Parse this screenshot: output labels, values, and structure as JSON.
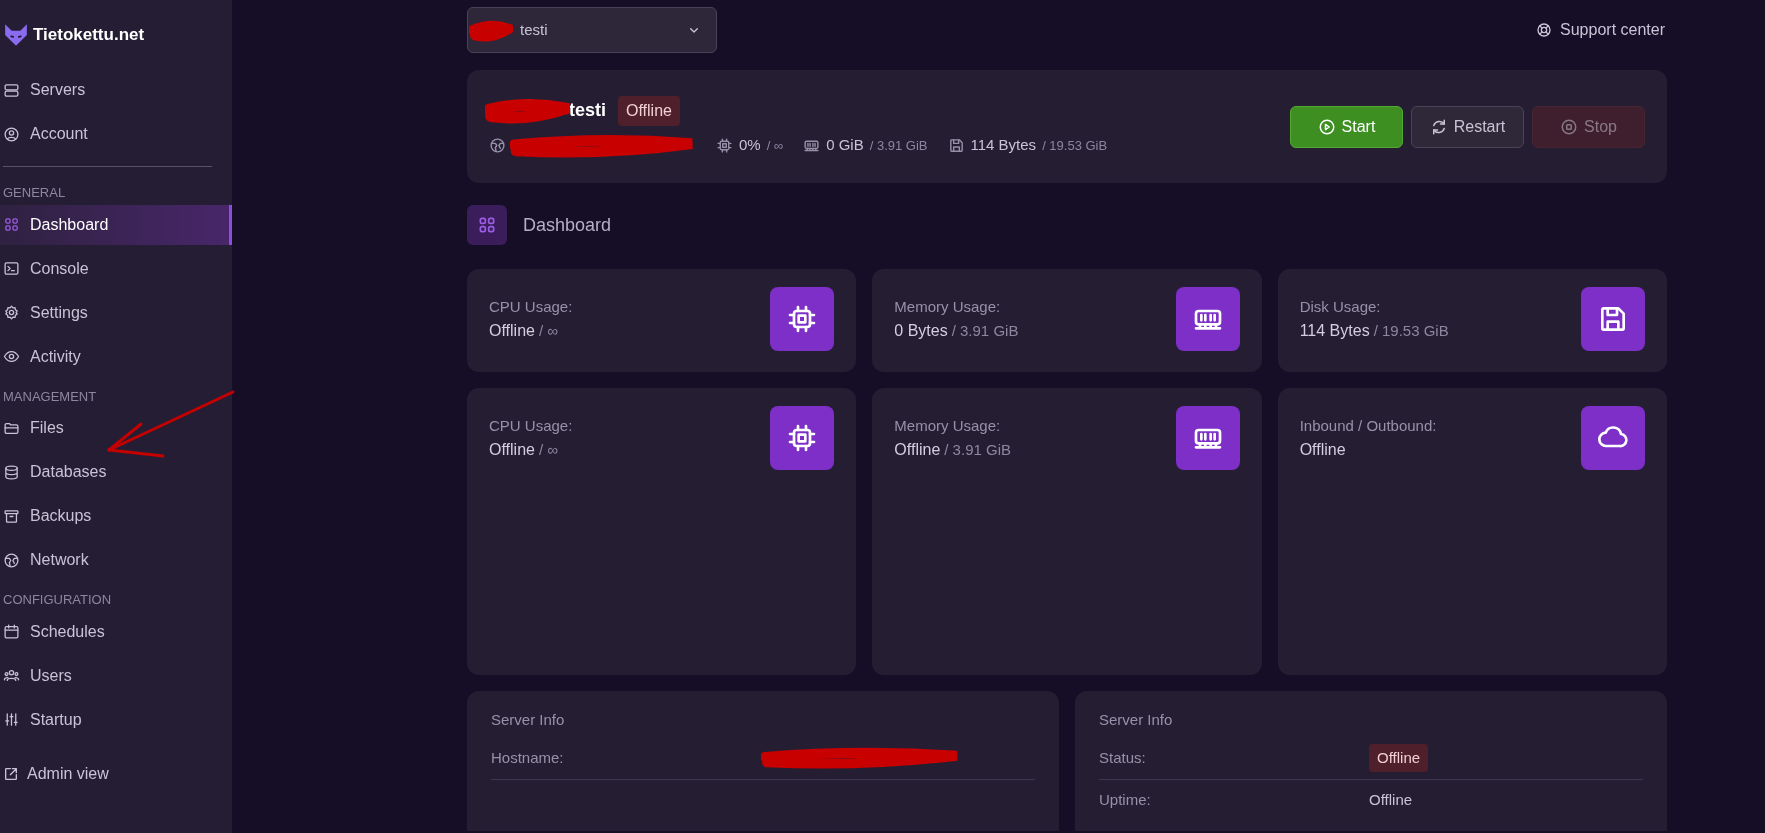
{
  "brand": {
    "name": "Tietokettu.net"
  },
  "sidebar": {
    "top_items": [
      {
        "label": "Servers",
        "kind": "server",
        "selected": false
      },
      {
        "label": "Account",
        "kind": "user",
        "selected": false
      }
    ],
    "sections": [
      {
        "title": "GENERAL",
        "items": [
          {
            "label": "Dashboard",
            "kind": "grid",
            "selected": true
          },
          {
            "label": "Console",
            "kind": "terminal",
            "selected": false
          },
          {
            "label": "Settings",
            "kind": "gear",
            "selected": false
          },
          {
            "label": "Activity",
            "kind": "eye",
            "selected": false
          }
        ]
      },
      {
        "title": "MANAGEMENT",
        "items": [
          {
            "label": "Files",
            "kind": "folder",
            "selected": false
          },
          {
            "label": "Databases",
            "kind": "database",
            "selected": false
          },
          {
            "label": "Backups",
            "kind": "archive",
            "selected": false
          },
          {
            "label": "Network",
            "kind": "globe",
            "selected": false
          }
        ]
      },
      {
        "title": "CONFIGURATION",
        "items": [
          {
            "label": "Schedules",
            "kind": "calendar",
            "selected": false
          },
          {
            "label": "Users",
            "kind": "users",
            "selected": false
          },
          {
            "label": "Startup",
            "kind": "sliders",
            "selected": false
          }
        ]
      }
    ],
    "footer_item": {
      "label": "Admin view",
      "kind": "external"
    }
  },
  "server_select": {
    "value": "testi"
  },
  "support_link": {
    "label": "Support center"
  },
  "server": {
    "name": "testi",
    "status": "Offline",
    "stats": [
      {
        "kind": "cpu",
        "value": "0%",
        "limit": "/ ∞"
      },
      {
        "kind": "memory",
        "value": "0 GiB",
        "limit": "/ 3.91 GiB"
      },
      {
        "kind": "disk",
        "value": "114 Bytes",
        "limit": "/ 19.53 GiB"
      }
    ]
  },
  "actions": [
    {
      "label": "Start",
      "kind": "start",
      "disabled": false
    },
    {
      "label": "Restart",
      "kind": "restart",
      "disabled": false
    },
    {
      "label": "Stop",
      "kind": "stop",
      "disabled": true
    }
  ],
  "page_title": "Dashboard",
  "stat_cards": [
    {
      "label": "CPU Usage:",
      "value": "Offline",
      "limit": "/ ∞",
      "kind": "cpu"
    },
    {
      "label": "Memory Usage:",
      "value": "0 Bytes",
      "limit": "/ 3.91 GiB",
      "kind": "memory"
    },
    {
      "label": "Disk Usage:",
      "value": "114 Bytes",
      "limit": "/ 19.53 GiB",
      "kind": "disk"
    },
    {
      "label": "CPU Usage:",
      "value": "Offline",
      "limit": "/ ∞",
      "kind": "cpu"
    },
    {
      "label": "Memory Usage:",
      "value": "Offline",
      "limit": "/ 3.91 GiB",
      "kind": "memory"
    },
    {
      "label": "Inbound / Outbound:",
      "value": "Offline",
      "kind": "cloud"
    }
  ],
  "info_panels": [
    {
      "title": "Server Info",
      "rows": [
        {
          "label": "Hostname:",
          "kind": "redacted"
        }
      ]
    },
    {
      "title": "Server Info",
      "rows": [
        {
          "label": "Status:",
          "kind": "badge",
          "value": "Offline"
        },
        {
          "label": "Uptime:",
          "kind": "text",
          "value": "Offline"
        }
      ]
    }
  ]
}
